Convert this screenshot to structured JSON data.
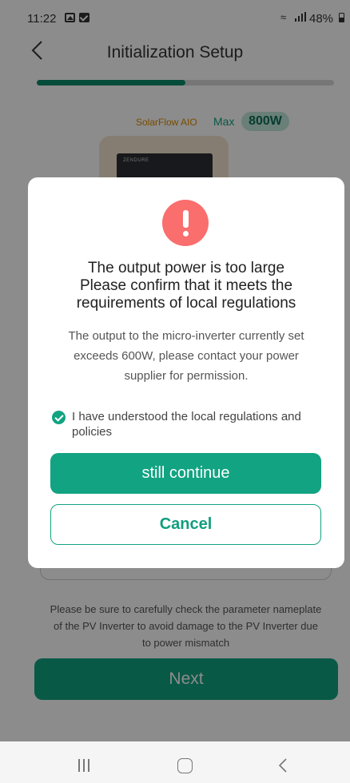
{
  "status_bar": {
    "time": "11:22",
    "battery_text": "48%",
    "wifi_icon": "wifi-icon",
    "signal_icon": "signal-icon"
  },
  "header": {
    "title": "Initialization Setup",
    "back_icon": "back-arrow-icon"
  },
  "progress": {
    "fraction": 0.5
  },
  "device": {
    "name": "SolarFlow AIO",
    "max_label": "Max",
    "max_value": "800W",
    "logo_text": "ZENDURE"
  },
  "warning_note": "Please be sure to carefully check the parameter nameplate of the PV Inverter to avoid damage to the PV Inverter due to power mismatch",
  "next_label": "Next",
  "dialog": {
    "icon": "exclamation-icon",
    "title_lines": [
      "The output power is too large",
      "Please confirm that it meets the",
      "requirements of local regulations"
    ],
    "message": "The output to the micro-inverter currently set exceeds 600W, please contact your power supplier for permission.",
    "agreement_text": "I have understood the local regulations and policies",
    "agreement_checked": true,
    "continue_label": "still continue",
    "cancel_label": "Cancel"
  },
  "colors": {
    "accent": "#12a382",
    "alert": "#fa6e6e",
    "device_name": "#d98b00"
  }
}
